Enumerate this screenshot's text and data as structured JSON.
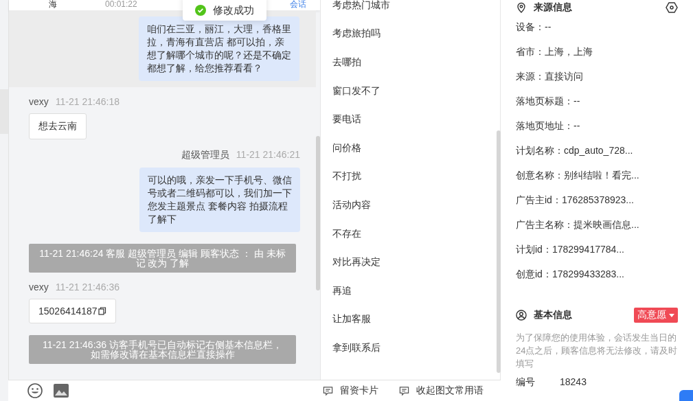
{
  "session_row": {
    "city": "海",
    "duration": "00:01:22",
    "link": "会话"
  },
  "toast": {
    "text": "修改成功"
  },
  "messages": [
    {
      "kind": "agent",
      "text": "咱们在三亚，丽江，大理，香格里拉，青海有直营店 都可以拍，亲想了解哪个城市的呢？还是不确定都想了解，给您推荐看看？",
      "highlighted": true
    },
    {
      "kind": "visitor",
      "sender": "vexy",
      "time": "11-21 21:46:18",
      "text": "想去云南"
    },
    {
      "kind": "agent",
      "sender": "超级管理员",
      "time": "11-21 21:46:21",
      "text": "可以的哦，亲发一下手机号、微信号或者二维码都可以，我们加一下您发主题景点 套餐内容 拍摄流程了解下",
      "highlighted": false
    },
    {
      "kind": "system",
      "text": "11-21 21:46:24 客服 超级管理员 编辑 顾客状态 ： 由 未标记 改为 了解"
    },
    {
      "kind": "phone",
      "sender": "vexy",
      "time": "11-21 21:46:36",
      "text": "15026414187"
    },
    {
      "kind": "system",
      "text": "11-21 21:46:36 访客手机号已自动标记右侧基本信息栏，如需修改请在基本信息栏直接操作"
    }
  ],
  "quick_phrases": [
    "考虑热门城市",
    "考虑旅拍吗",
    "去哪拍",
    "窗口发不了",
    "要电话",
    "问价格",
    "不打扰",
    "活动内容",
    "不存在",
    "对比再决定",
    "再追",
    "让加客服",
    "拿到联系后"
  ],
  "toolbar": {
    "card": "留资卡片",
    "collapse": "收起图文常用语"
  },
  "source_info": {
    "title": "来源信息",
    "fields": [
      "设备：--",
      "省市：上海，上海",
      "来源：直接访问",
      "落地页标题：--",
      "落地页地址：--",
      "计划名称：cdp_auto_728...",
      "创意名称：别纠结啦！看完...",
      "广告主id：176285378923...",
      "广告主名称：提米映画信息...",
      "计划id：178299417784...",
      "创意id：178299433283..."
    ]
  },
  "basic_info": {
    "title": "基本信息",
    "intent": "高意愿",
    "notice": "为了保障您的使用体验，会话发生当日的24点之后，顾客信息将无法修改，请及时填写",
    "fields": [
      {
        "label": "编号",
        "value": "18243"
      }
    ]
  }
}
